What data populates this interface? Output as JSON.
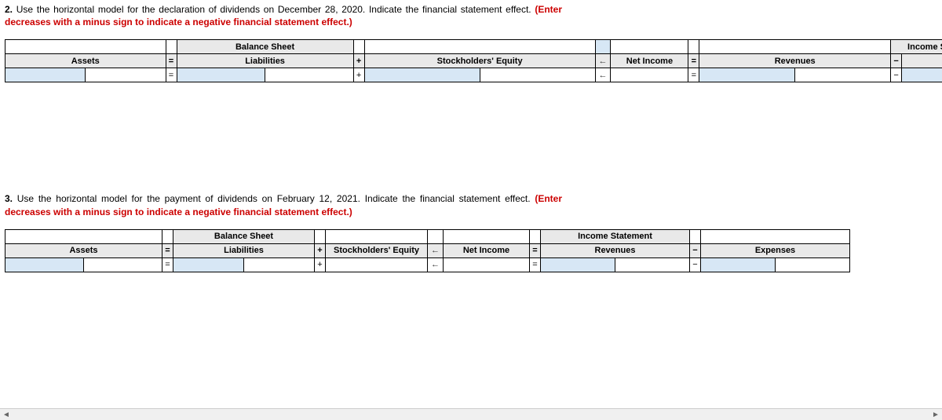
{
  "q2": {
    "num": "2.",
    "text_before": " Use the horizontal model for the declaration of dividends on December 28, 2020. Indicate the financial statement effect. ",
    "red": "(Enter decreases with a minus sign to indicate a negative financial statement effect.)"
  },
  "q3": {
    "num": "3.",
    "text_before": " Use the horizontal model for the payment of dividends on February 12, 2021. Indicate the financial statement effect. ",
    "red": "(Enter decreases with a minus sign to indicate a negative financial statement effect.)"
  },
  "headers": {
    "balance_sheet": "Balance Sheet",
    "income_statement": "Income Statement",
    "assets": "Assets",
    "liabilities": "Liabilities",
    "stockholders_equity": "Stockholders' Equity",
    "net_income": "Net Income",
    "revenues": "Revenues",
    "expenses": "Expenses"
  },
  "ops": {
    "eq": "=",
    "plus": "+",
    "minus": "−",
    "arrow_left": "←",
    "scroll_left": "◄",
    "scroll_right": "►"
  },
  "t1": {
    "w_assets": 210,
    "w_liab": 230,
    "w_se": 300,
    "w_ni": 100,
    "w_rev": 250,
    "w_exp": 250
  },
  "t2": {
    "w_assets": 200,
    "w_liab": 180,
    "w_se": 130,
    "w_ni": 110,
    "w_rev": 190,
    "w_exp": 190
  }
}
